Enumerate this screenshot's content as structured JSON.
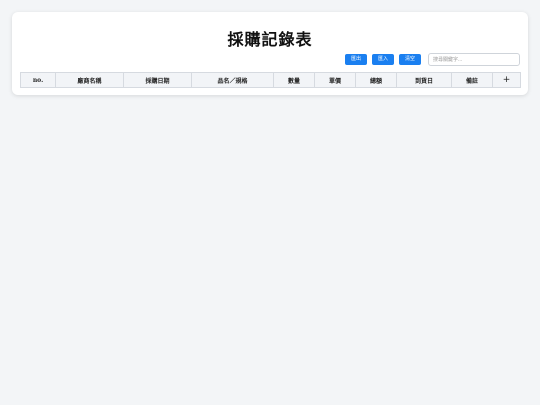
{
  "page": {
    "title": "採購記錄表"
  },
  "toolbar": {
    "export_label": "匯出",
    "import_label": "匯入",
    "clear_label": "清空",
    "search_placeholder": "搜尋關鍵字..."
  },
  "table": {
    "columns": [
      "no.",
      "廠商名稱",
      "採購日期",
      "品名／規格",
      "數量",
      "單價",
      "總額",
      "到貨日",
      "備註"
    ],
    "add_column_label": "+"
  }
}
